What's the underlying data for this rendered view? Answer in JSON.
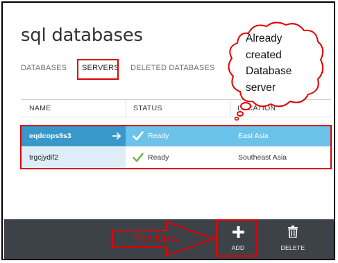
{
  "page": {
    "title": "sql databases"
  },
  "tabs": [
    {
      "label": "DATABASES",
      "active": false
    },
    {
      "label": "SERVERS",
      "active": true
    },
    {
      "label": "DELETED DATABASES",
      "active": false
    }
  ],
  "table": {
    "columns": [
      "NAME",
      "STATUS",
      "LOCATION"
    ],
    "rows": [
      {
        "name": "eqdcops9s3",
        "status": "Ready",
        "location": "East Asia",
        "selected": true
      },
      {
        "name": "trgcjydif2",
        "status": "Ready",
        "location": "Southeast Asia",
        "selected": false
      }
    ]
  },
  "commands": {
    "add_label": "ADD",
    "delete_label": "DELETE"
  },
  "annotations": {
    "cloud_lines": [
      "Already",
      "created",
      "Database",
      "server"
    ],
    "arrow_label": "For New"
  },
  "colors": {
    "selected_name_bg": "#3798c9",
    "selected_row_bg": "#6cc3ea",
    "command_bar_bg": "#3d4249",
    "check_green": "#7ab648",
    "annotation_red": "#e00000"
  },
  "icons": {
    "row_arrow": "arrow-right-icon",
    "status": "checkmark-icon",
    "add": "plus-icon",
    "delete": "trash-icon"
  }
}
